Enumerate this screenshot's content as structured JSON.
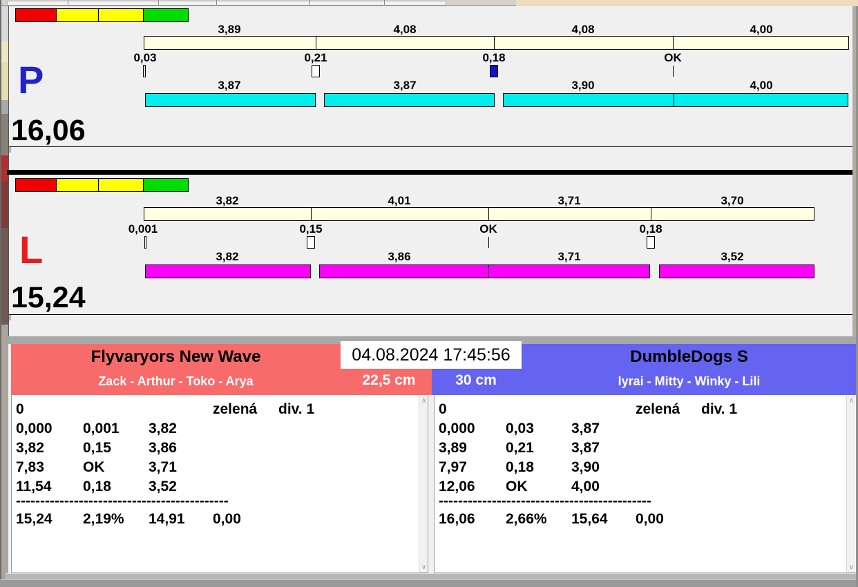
{
  "datetime": "04.08.2024 17:45:56",
  "lanes": [
    {
      "letter": "P",
      "letter_color": "#2222cc",
      "bar_color": "#00eeee",
      "total": "16,06",
      "splits": [
        "3,89",
        "4,08",
        "4,08",
        "4,00"
      ],
      "changes": [
        "0,03",
        "0,21",
        "0,18",
        "OK"
      ],
      "dog_times": [
        "3,87",
        "3,87",
        "3,90",
        "4,00"
      ]
    },
    {
      "letter": "L",
      "letter_color": "#e81c1c",
      "bar_color": "#fb00fb",
      "total": "15,24",
      "splits": [
        "3,82",
        "4,01",
        "3,71",
        "3,70"
      ],
      "changes": [
        "0,001",
        "0,15",
        "OK",
        "0,18"
      ],
      "dog_times": [
        "3,82",
        "3,86",
        "3,71",
        "3,52"
      ]
    }
  ],
  "traffic_light_colors": [
    "#f20000",
    "#ffff00",
    "#ffff00",
    "#00dd00"
  ],
  "teams": [
    {
      "name": "Flyvaryors New Wave",
      "dogs": "Zack - Arthur - Toko - Arya",
      "jump_height": "22,5 cm",
      "panel_color": "#f76b6b",
      "status": "0",
      "light": "zelená",
      "division": "div. 1",
      "rows": [
        [
          "0,000",
          "0,001",
          "3,82"
        ],
        [
          "3,82",
          "0,15",
          "3,86"
        ],
        [
          "7,83",
          "OK",
          "3,71"
        ],
        [
          "11,54",
          "0,18",
          "3,52"
        ]
      ],
      "separator": "--------------------------------------------",
      "summary": [
        "15,24",
        "2,19%",
        "14,91",
        "0,00"
      ]
    },
    {
      "name": "DumbleDogs S",
      "dogs": "Iyrai - Mitty - Winky - Lili",
      "jump_height": "30 cm",
      "panel_color": "#6464f0",
      "status": "0",
      "light": "zelená",
      "division": "div. 1",
      "rows": [
        [
          "0,000",
          "0,03",
          "3,87"
        ],
        [
          "3,89",
          "0,21",
          "3,87"
        ],
        [
          "7,97",
          "0,18",
          "3,90"
        ],
        [
          "12,06",
          "OK",
          "4,00"
        ]
      ],
      "separator": "--------------------------------------------",
      "summary": [
        "16,06",
        "2,66%",
        "15,64",
        "0,00"
      ]
    }
  ],
  "scrollbar": {
    "up": "∧",
    "down": "∨"
  }
}
